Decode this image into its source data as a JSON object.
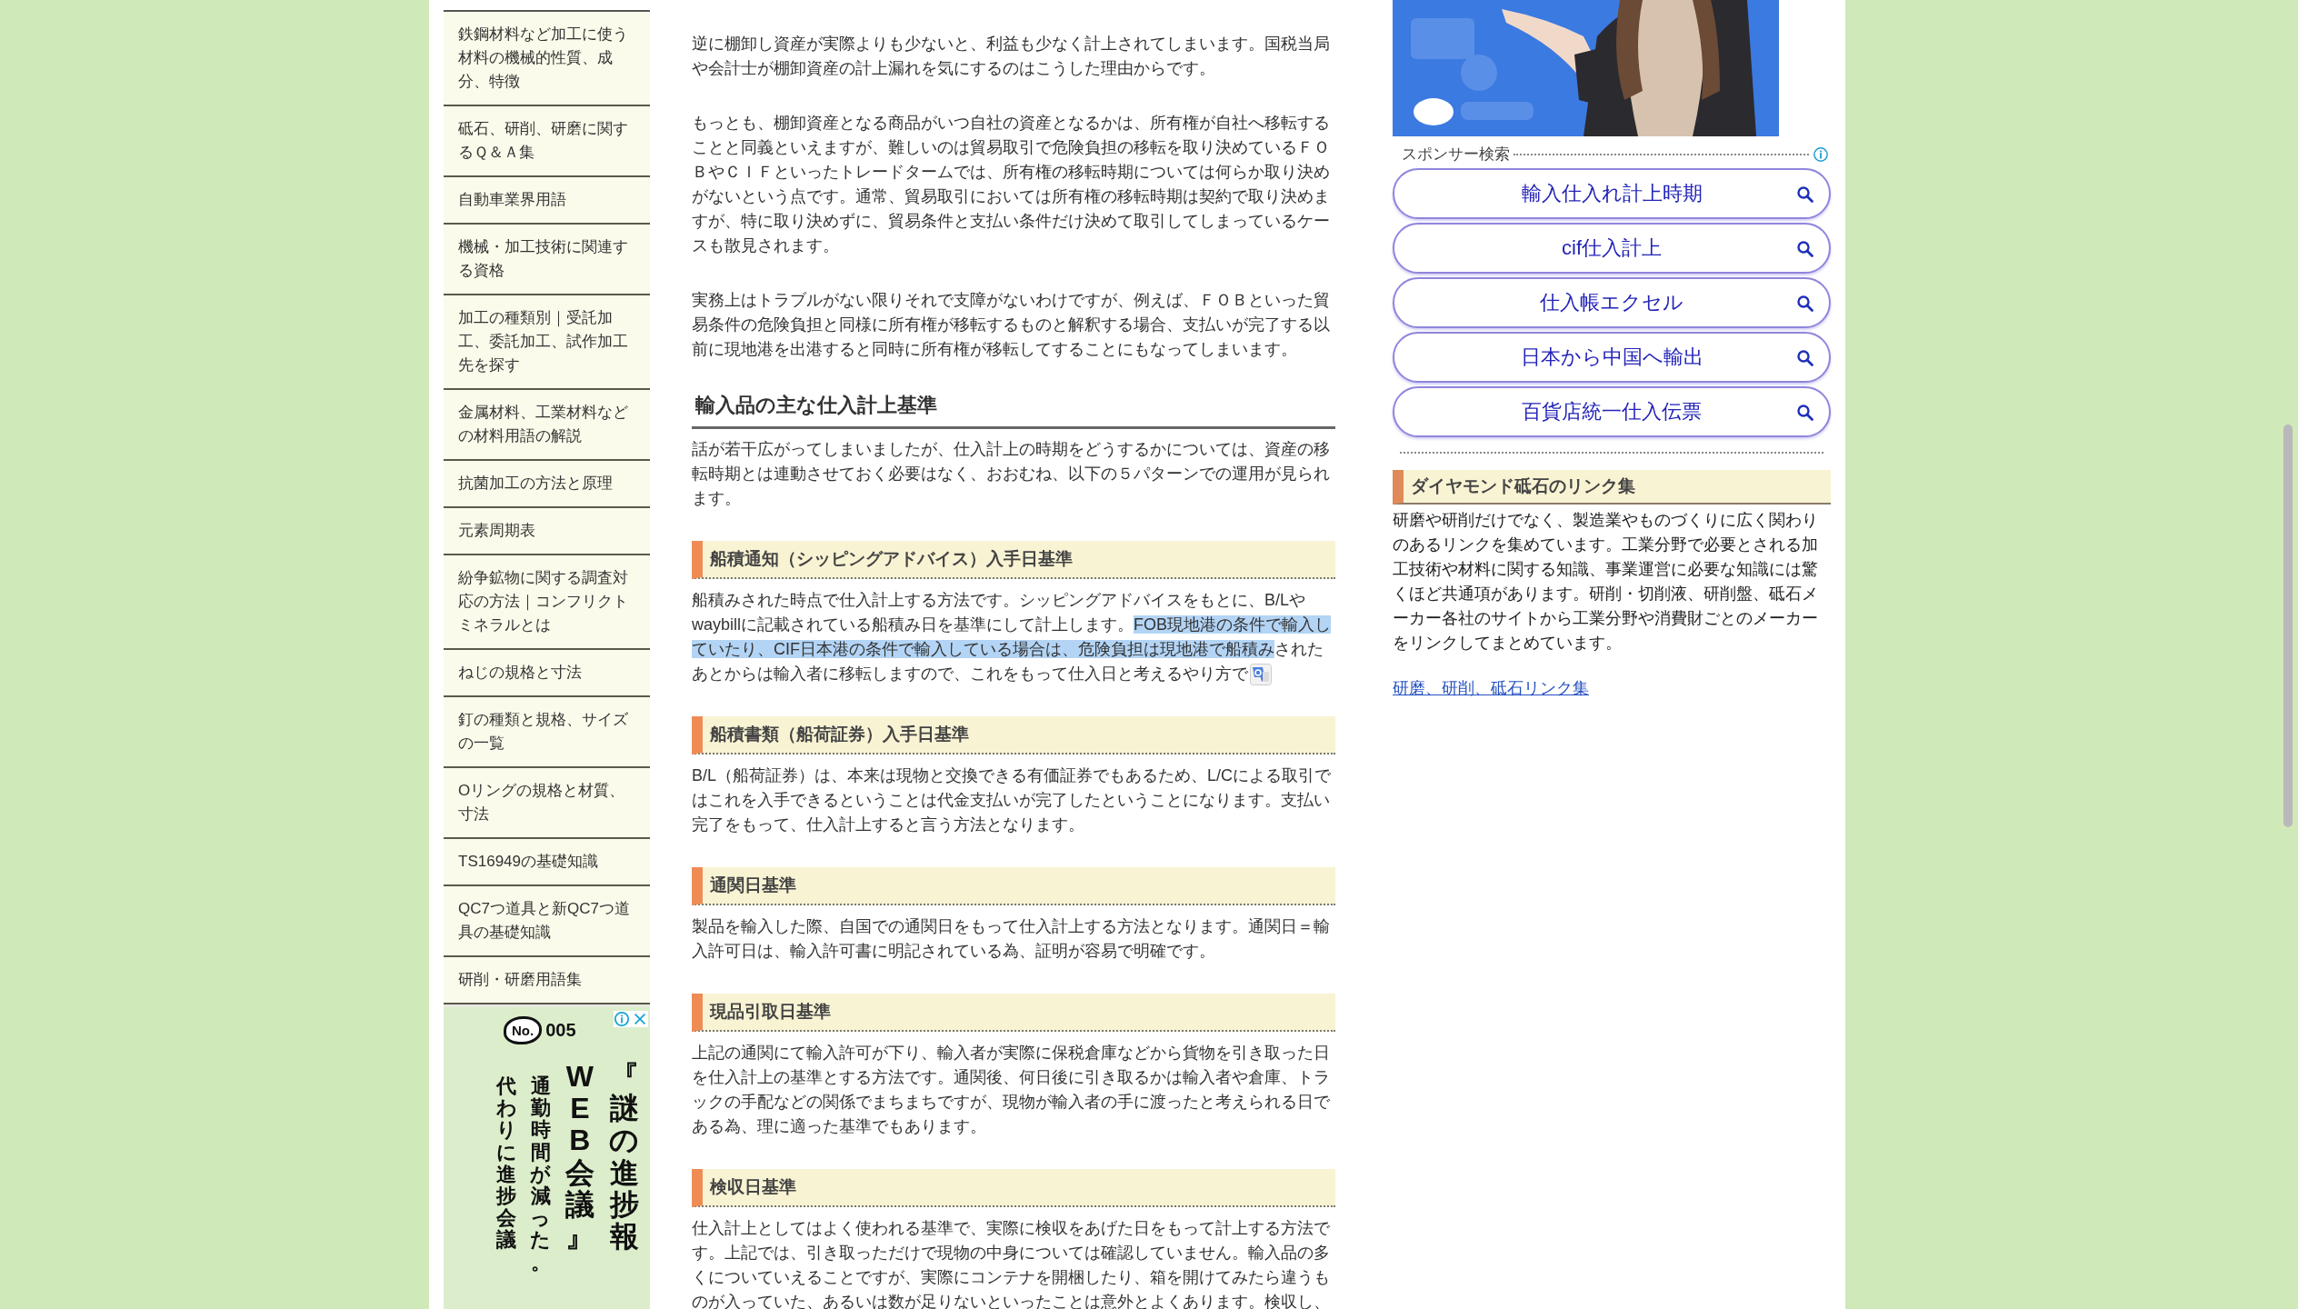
{
  "sidebar": {
    "items": [
      {
        "label": "鉄鋼材料など加工に使う材料の機械的性質、成分、特徴"
      },
      {
        "label": "砥石、研削、研磨に関するＱ＆Ａ集"
      },
      {
        "label": "自動車業界用語"
      },
      {
        "label": "機械・加工技術に関連する資格"
      },
      {
        "label": "加工の種類別｜受託加工、委託加工、試作加工先を探す"
      },
      {
        "label": "金属材料、工業材料などの材料用語の解説"
      },
      {
        "label": "抗菌加工の方法と原理"
      },
      {
        "label": "元素周期表"
      },
      {
        "label": "紛争鉱物に関する調査対応の方法｜コンフリクトミネラルとは"
      },
      {
        "label": "ねじの規格と寸法"
      },
      {
        "label": "釘の種類と規格、サイズの一覧"
      },
      {
        "label": "Oリングの規格と材質、寸法"
      },
      {
        "label": "TS16949の基礎知識"
      },
      {
        "label": "QC7つ道具と新QC7つ道具の基礎知識"
      },
      {
        "label": "研削・研磨用語集"
      }
    ],
    "ad": {
      "badge": "No.",
      "number": "005",
      "columns": [
        {
          "text": "代わりに進捗会議"
        },
        {
          "text": "通勤時間が減った。"
        },
        {
          "text": "WEB会議』"
        },
        {
          "text": "『謎の進捗報"
        }
      ]
    }
  },
  "article": {
    "blocks": [
      {
        "kind": "paragraph",
        "text": "逆に棚卸し資産が実際よりも少ないと、利益も少なく計上されてしまいます。国税当局や会計士が棚卸資産の計上漏れを気にするのはこうした理由からです。"
      },
      {
        "kind": "paragraph",
        "text": "もっとも、棚卸資産となる商品がいつ自社の資産となるかは、所有権が自社へ移転することと同義といえますが、難しいのは貿易取引で危険負担の移転を取り決めているＦＯＢやＣＩＦといったトレードタームでは、所有権の移転時期については何らか取り決めがないという点です。通常、貿易取引においては所有権の移転時期は契約で取り決めますが、特に取り決めずに、貿易条件と支払い条件だけ決めて取引してしまっているケースも散見されます。"
      },
      {
        "kind": "paragraph",
        "text": "実務上はトラブルがない限りそれで支障がないわけですが、例えば、ＦＯＢといった貿易条件の危険負担と同様に所有権が移転するものと解釈する場合、支払いが完了する以前に現地港を出港すると同時に所有権が移転してすることにもなってしまいます。"
      },
      {
        "kind": "heading",
        "text": "輸入品の主な仕入計上基準"
      },
      {
        "kind": "paragraph",
        "text": "話が若干広がってしまいましたが、仕入計上の時期をどうするかについては、資産の移転時期とは連動させておく必要はなく、おおむね、以下の５パターンでの運用が見られます。"
      },
      {
        "kind": "subheading",
        "text": "船積通知（シッピングアドバイス）入手日基準"
      },
      {
        "kind": "selection",
        "segments": [
          {
            "text": "船積みされた時点で仕入計上する方法です。シッピングアドバイスをもとに、B/Lやwaybillに記載されている船積み日を基準にして計上します。",
            "highlighted": false
          },
          {
            "text": "FOB現地港の条件で輸入していたり、CIF日本港の条件で輸入している場合は、危険負担は現地港で船積み",
            "highlighted": true
          },
          {
            "text": "されたあとからは輸入者に移転しますので、これをもって仕入日と考えるやり方で",
            "highlighted": false
          }
        ]
      },
      {
        "kind": "subheading",
        "text": "船積書類（船荷証券）入手日基準"
      },
      {
        "kind": "paragraph",
        "text": "B/L（船荷証券）は、本来は現物と交換できる有価証券でもあるため、L/Cによる取引ではこれを入手できるということは代金支払いが完了したということになります。支払い完了をもって、仕入計上すると言う方法となります。"
      },
      {
        "kind": "subheading",
        "text": "通関日基準"
      },
      {
        "kind": "paragraph",
        "text": "製品を輸入した際、自国での通関日をもって仕入計上する方法となります。通関日＝輸入許可日は、輸入許可書に明記されている為、証明が容易で明確です。"
      },
      {
        "kind": "subheading",
        "text": "現品引取日基準"
      },
      {
        "kind": "paragraph",
        "text": "上記の通関にて輸入許可が下り、輸入者が実際に保税倉庫などから貨物を引き取った日を仕入計上の基準とする方法です。通関後、何日後に引き取るかは輸入者や倉庫、トラックの手配などの関係でまちまちですが、現物が輸入者の手に渡ったと考えられる日である為、理に適った基準でもあります。"
      },
      {
        "kind": "subheading",
        "text": "検収日基準"
      },
      {
        "kind": "paragraph",
        "text": "仕入計上としてはよく使われる基準で、実際に検収をあげた日をもって計上する方法です。上記では、引き取っただけで現物の中身については確認していません。輸入品の多くについていえることですが、実際にコンテナを開梱したり、箱を開けてみたら違うものが入っていた、あるいは数が足りないといったことは意外とよくあります。検収し、"
      }
    ]
  },
  "right_sidebar": {
    "sponsor_search": {
      "label": "スポンサー検索",
      "buttons": [
        "輸入仕入れ計上時期",
        "cif仕入計上",
        "仕入帳エクセル",
        "日本から中国へ輸出",
        "百貨店統一仕入伝票"
      ]
    },
    "links_section": {
      "heading": "ダイヤモンド砥石のリンク集",
      "text": "研磨や研削だけでなく、製造業やものづくりに広く関わりのあるリンクを集めています。工業分野で必要とされる加工技術や材料に関する知識、事業運営に必要な知識には驚くほど共通項があります。研削・切削液、研削盤、砥石メーカー各社のサイトから工業分野や消費財ごとのメーカーをリンクしてまとめています。",
      "link": "研磨、研削、砥石リンク集"
    }
  }
}
